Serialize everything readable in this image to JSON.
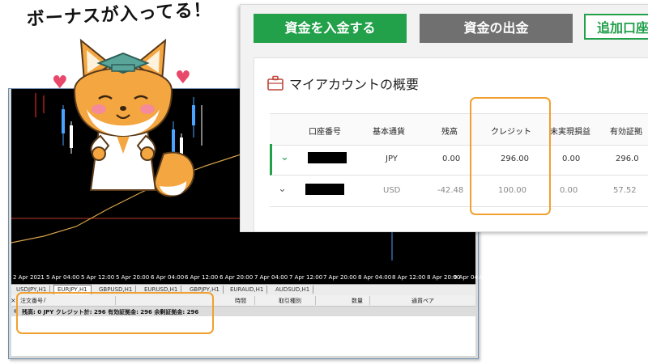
{
  "caption": "ボーナスが入ってる！",
  "mt4": {
    "time_axis": [
      "2 Apr 2021",
      "5 Apr 04:00",
      "5 Apr 12:00",
      "5 Apr 20:00",
      "6 Apr 04:00",
      "6 Apr 12:00",
      "6 Apr 20:00",
      "7 Apr 04:00",
      "7 Apr 12:00",
      "7 Apr 20:00",
      "8 Apr 04:00",
      "8 Apr 12:00",
      "8 Apr 20:00",
      "9 Apr 04:00"
    ],
    "chart_tabs": [
      "USDJPY,H1",
      "EURJPY,H1",
      "GBPUSD,H1",
      "EURUSD,H1",
      "GBPJPY,H1",
      "EURAUD,H1",
      "AUDSUD,H1"
    ],
    "active_tab": "EURJPY,H1",
    "terminal": {
      "columns": [
        "注文番号",
        "/",
        "時間",
        "取引種別",
        "数量",
        "通貨ペア"
      ],
      "summary": "残高: 0 JPY  クレジット計: 296  有効証拠金: 296  余剰証拠金: 296"
    }
  },
  "member": {
    "buttons": {
      "deposit": "資金を入金する",
      "withdraw": "資金の出金",
      "add": "追加口座"
    },
    "panel_title": "マイアカウントの概要",
    "table": {
      "headers": [
        "口座番号",
        "基本通貨",
        "残高",
        "クレジット",
        "未実現損益",
        "有効証拠"
      ],
      "rows": [
        {
          "currency": "JPY",
          "balance": "0.00",
          "credit": "296.00",
          "unrealized": "0.00",
          "equity": "296.0"
        },
        {
          "currency": "USD",
          "balance": "-42.48",
          "credit": "100.00",
          "unrealized": "0.00",
          "equity": "57.52"
        }
      ]
    }
  },
  "colors": {
    "accent_green": "#22a04a",
    "highlight_orange": "#f0a030",
    "chart_background": "#000000"
  },
  "icons": [
    "briefcase-icon",
    "chevron-down-icon",
    "fox-mascot",
    "heart-icon"
  ]
}
